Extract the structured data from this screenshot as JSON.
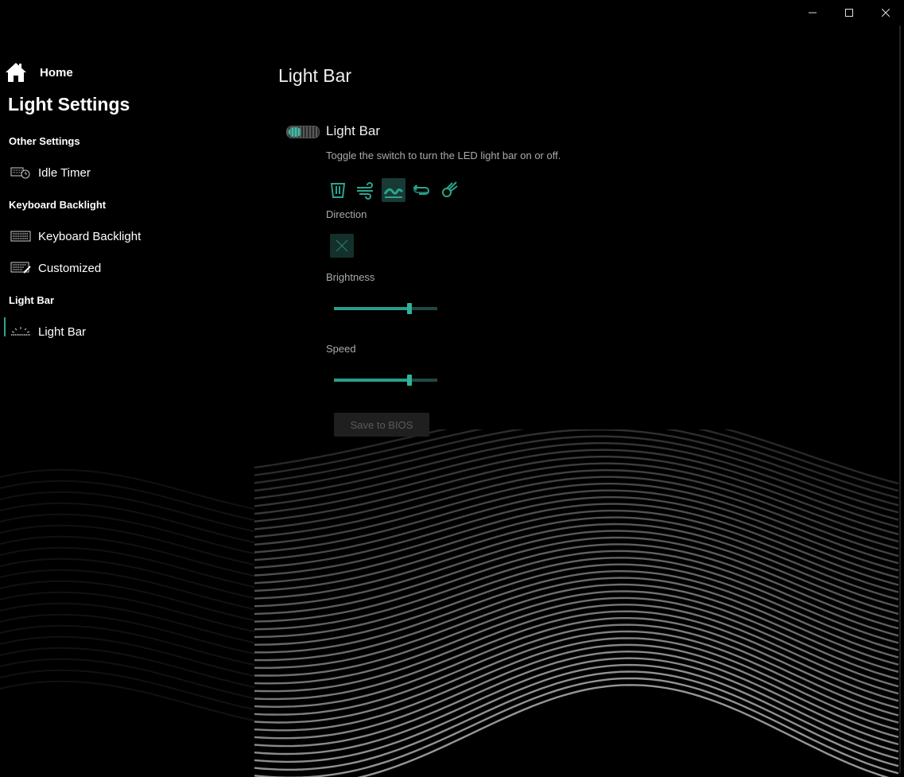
{
  "sidebar": {
    "home_label": "Home",
    "app_title": "Light Settings",
    "groups": [
      {
        "title": "Other Settings",
        "items": [
          {
            "label": "Idle Timer"
          }
        ]
      },
      {
        "title": "Keyboard Backlight",
        "items": [
          {
            "label": "Keyboard Backlight"
          },
          {
            "label": "Customized"
          }
        ]
      },
      {
        "title": "Light Bar",
        "items": [
          {
            "label": "Light Bar"
          }
        ]
      }
    ]
  },
  "main": {
    "page_title": "Light Bar",
    "section_title": "Light Bar",
    "section_desc": "Toggle the switch to turn the LED light bar on or off.",
    "toggle_state": "on",
    "effects": [
      {
        "name": "bar-icon"
      },
      {
        "name": "wind-icon"
      },
      {
        "name": "wave-icon",
        "selected": true
      },
      {
        "name": "loop-icon"
      },
      {
        "name": "comet-icon"
      }
    ],
    "direction_label": "Direction",
    "brightness_label": "Brightness",
    "brightness_value": 0.73,
    "speed_label": "Speed",
    "speed_value": 0.73,
    "save_label": "Save to BIOS"
  },
  "colors": {
    "accent": "#2aa58e",
    "background": "#000000",
    "text": "#ffffff",
    "muted_text": "#aaaaaa"
  }
}
